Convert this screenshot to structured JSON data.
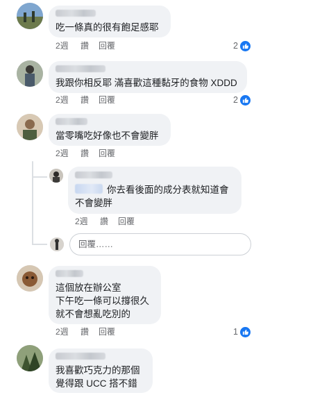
{
  "comments": [
    {
      "text": "吃一條真的很有飽足感耶",
      "time": "2週",
      "like_label": "讚",
      "reply_label": "回覆",
      "reactions": "2"
    },
    {
      "text": "我跟你相反耶 滿喜歡這種黏牙的食物 XDDD",
      "time": "2週",
      "like_label": "讚",
      "reply_label": "回覆",
      "reactions": "2"
    },
    {
      "text": "當零嘴吃好像也不會變胖",
      "time": "2週",
      "like_label": "讚",
      "reply_label": "回覆",
      "reactions": "",
      "reply": {
        "text": "你去看後面的成分表就知道會\n不會變胖",
        "time": "2週",
        "like_label": "讚",
        "reply_label": "回覆"
      },
      "reply_box_placeholder": "回覆……"
    },
    {
      "text": "這個放在辦公室\n下午吃一條可以撐很久\n就不會想亂吃別的",
      "time": "2週",
      "like_label": "讚",
      "reply_label": "回覆",
      "reactions": "1"
    },
    {
      "text": "我喜歡巧克力的那個\n覺得跟 UCC 搭不錯"
    }
  ],
  "icons": {
    "reaction": "like-thumb-icon"
  },
  "colors": {
    "accent": "#1877f2",
    "bubble": "#f0f2f5",
    "meta": "#65676b"
  }
}
